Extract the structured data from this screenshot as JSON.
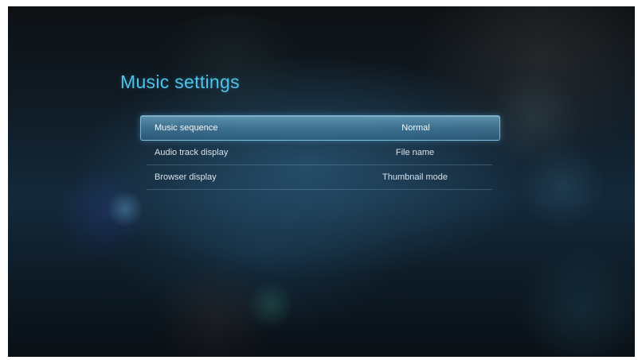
{
  "page_title": "Music settings",
  "settings": [
    {
      "label": "Music sequence",
      "value": "Normal",
      "selected": true
    },
    {
      "label": "Audio track display",
      "value": "File name",
      "selected": false
    },
    {
      "label": "Browser display",
      "value": "Thumbnail mode",
      "selected": false
    }
  ],
  "colors": {
    "title": "#4ec3ea",
    "highlight": "#5a9dc0",
    "text": "#d6e2ea"
  }
}
